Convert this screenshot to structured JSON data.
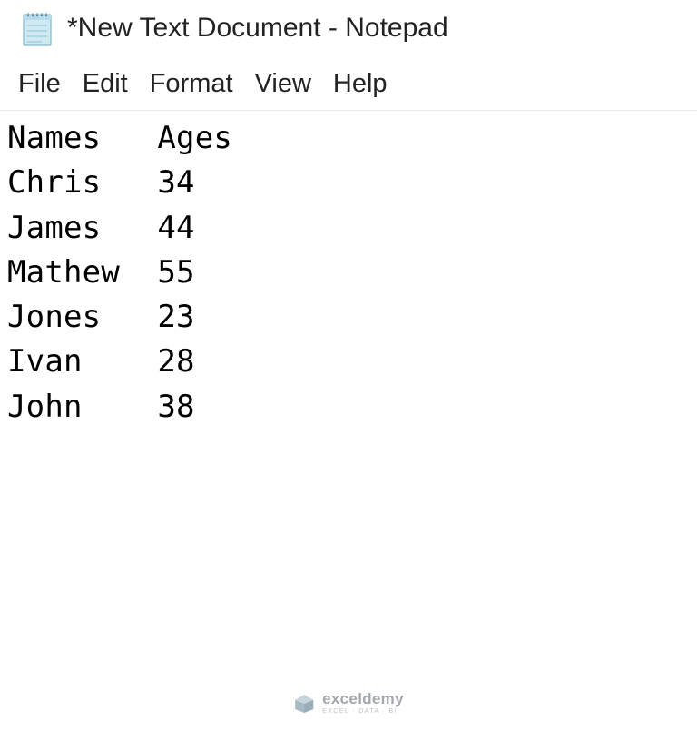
{
  "title_bar": {
    "icon_name": "notepad-icon",
    "title": "*New Text Document - Notepad"
  },
  "menu": {
    "items": [
      {
        "label": "File"
      },
      {
        "label": "Edit"
      },
      {
        "label": "Format"
      },
      {
        "label": "View"
      },
      {
        "label": "Help"
      }
    ]
  },
  "document": {
    "lines": [
      {
        "col1": "Names",
        "col2": "Ages"
      },
      {
        "col1": "Chris",
        "col2": "34"
      },
      {
        "col1": "James",
        "col2": "44"
      },
      {
        "col1": "Mathew",
        "col2": "55"
      },
      {
        "col1": "Jones",
        "col2": "23"
      },
      {
        "col1": "Ivan",
        "col2": "28"
      },
      {
        "col1": "John",
        "col2": "38"
      }
    ],
    "col1_width": 8
  },
  "watermark": {
    "name": "exceldemy",
    "tagline": "EXCEL · DATA · BI"
  }
}
